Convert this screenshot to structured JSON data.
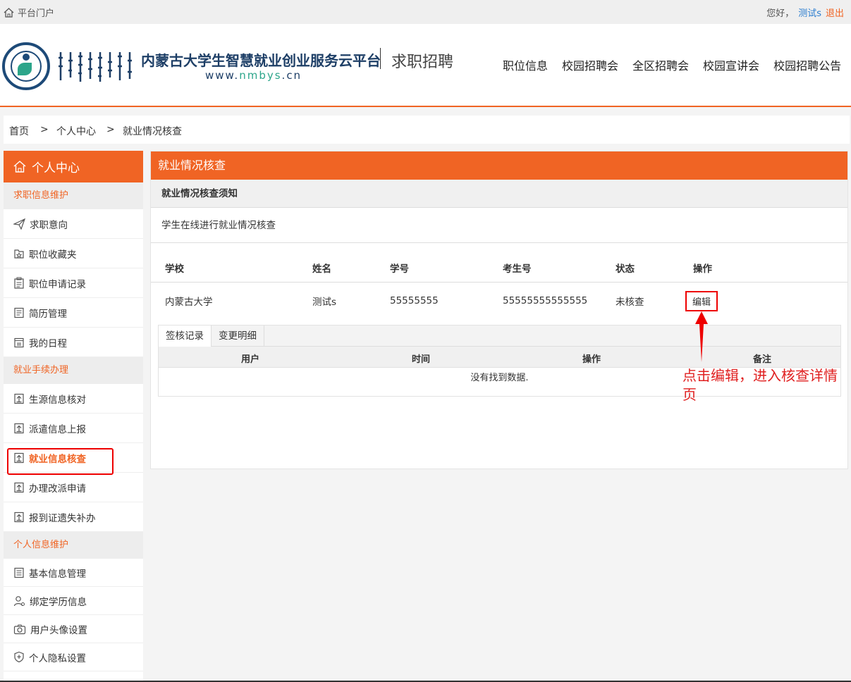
{
  "topbar": {
    "portal": "平台门户",
    "greeting": "您好，",
    "username": "测试s",
    "logout": "退出"
  },
  "header": {
    "title": "内蒙古大学生智慧就业创业服务云平台",
    "url_prefix": "www.",
    "url_brand": "nmbys",
    "url_suffix": ".cn",
    "subtitle": "求职招聘",
    "nav": [
      "职位信息",
      "校园招聘会",
      "全区招聘会",
      "校园宣讲会",
      "校园招聘公告"
    ]
  },
  "breadcrumb": {
    "home": "首页",
    "sep": ">",
    "center": "个人中心",
    "current": "就业情况核查"
  },
  "sidebar": {
    "title": "个人中心",
    "sections": [
      {
        "title": "求职信息维护",
        "items": [
          "求职意向",
          "职位收藏夹",
          "职位申请记录",
          "简历管理",
          "我的日程"
        ]
      },
      {
        "title": "就业手续办理",
        "items": [
          "生源信息核对",
          "派遣信息上报",
          "就业信息核查",
          "办理改派申请",
          "报到证遗失补办"
        ]
      },
      {
        "title": "个人信息维护",
        "items": [
          "基本信息管理",
          "绑定学历信息",
          "用户头像设置",
          "个人隐私设置"
        ]
      }
    ]
  },
  "main": {
    "title": "就业情况核查",
    "notice_title": "就业情况核查须知",
    "notice_text": "学生在线进行就业情况核查",
    "columns": [
      "学校",
      "姓名",
      "学号",
      "考生号",
      "状态",
      "操作"
    ],
    "row": {
      "school": "内蒙古大学",
      "name": "测试s",
      "student_no": "55555555",
      "exam_no": "55555555555555",
      "status": "未核查",
      "action": "编辑"
    },
    "tabs": [
      "签核记录",
      "变更明细"
    ],
    "sub_columns": [
      "用户",
      "时间",
      "操作",
      "备注"
    ],
    "empty_text": "没有找到数据."
  },
  "annotation": {
    "text": "点击编辑，进入核查详情页",
    "color": "#e02020"
  },
  "colors": {
    "accent": "#f06424",
    "brand": "#1d3e66",
    "link": "#2a7ccf"
  }
}
